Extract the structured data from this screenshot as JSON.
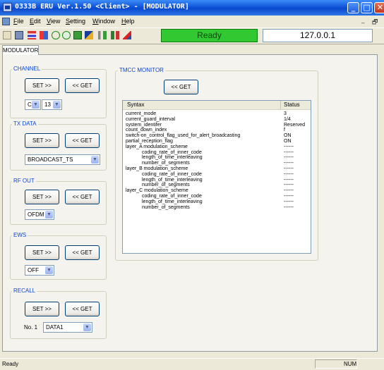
{
  "window": {
    "title": "0333B ERU Ver.1.50 <Client> - [MODULATOR]",
    "min": "_",
    "max": "□",
    "close": "✕"
  },
  "menu": {
    "items": [
      {
        "accel": "F",
        "rest": "ile"
      },
      {
        "accel": "E",
        "rest": "dit"
      },
      {
        "accel": "V",
        "rest": "iew"
      },
      {
        "accel": "S",
        "rest": "etting"
      },
      {
        "accel": "W",
        "rest": "indow"
      },
      {
        "accel": "H",
        "rest": "elp"
      }
    ],
    "mdi_min": "_",
    "mdi_restore": "🗗"
  },
  "toolbar": {
    "status": "Ready",
    "ip": "127.0.0.1"
  },
  "tab": "MODULATOR",
  "buttons": {
    "set": "SET >>",
    "get": "<< GET"
  },
  "channel": {
    "label": "CHANNEL",
    "band": "C",
    "number": "13"
  },
  "tx_data": {
    "label": "TX DATA",
    "value": "BROADCAST_TS"
  },
  "rf_out": {
    "label": "RF OUT",
    "value": "OFDM"
  },
  "ews": {
    "label": "EWS",
    "value": "OFF"
  },
  "recall": {
    "label": "RECALL",
    "no_label": "No. 1",
    "value": "DATA1"
  },
  "tmcc": {
    "label": "TMCC MONITOR",
    "get": "<< GET",
    "col_syntax": "Syntax",
    "col_status": "Status",
    "rows": [
      {
        "syntax": "current_mode",
        "status": "3",
        "indent": 0
      },
      {
        "syntax": "current_guard_interval",
        "status": "1/4",
        "indent": 0
      },
      {
        "syntax": "system_identifer",
        "status": "Reserved",
        "indent": 0
      },
      {
        "syntax": "count_down_index",
        "status": "f",
        "indent": 0
      },
      {
        "syntax": "switch-on_control_flag_used_for_alert_broadcasting",
        "status": "ON",
        "indent": 0
      },
      {
        "syntax": "partial_reception_flag",
        "status": "ON",
        "indent": 0
      },
      {
        "syntax": "layer_A  modulation_scheme",
        "status": "------",
        "indent": 0
      },
      {
        "syntax": "coding_rate_of_inner_code",
        "status": "------",
        "indent": 1
      },
      {
        "syntax": "length_of_time_interleaving",
        "status": "------",
        "indent": 1
      },
      {
        "syntax": "number_of_segments",
        "status": "------",
        "indent": 1
      },
      {
        "syntax": "layer_B  modulation_scheme",
        "status": "------",
        "indent": 0
      },
      {
        "syntax": "coding_rate_of_inner_code",
        "status": "------",
        "indent": 1
      },
      {
        "syntax": "length_of_time_interleaving",
        "status": "------",
        "indent": 1
      },
      {
        "syntax": "number_of_segments",
        "status": "------",
        "indent": 1
      },
      {
        "syntax": "layer_C  modulation_scheme",
        "status": "------",
        "indent": 0
      },
      {
        "syntax": "coding_rate_of_inner_code",
        "status": "------",
        "indent": 1
      },
      {
        "syntax": "length_of_time_interleaving",
        "status": "------",
        "indent": 1
      },
      {
        "syntax": "number_of_segments",
        "status": "------",
        "indent": 1
      }
    ]
  },
  "statusbar": {
    "text": "Ready",
    "num": "NUM"
  }
}
